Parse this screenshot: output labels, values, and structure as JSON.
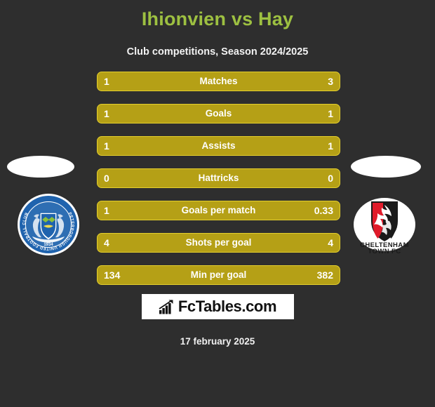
{
  "header": {
    "title": "Ihionvien vs Hay",
    "subtitle": "Club competitions, Season 2024/2025"
  },
  "teams": {
    "home": {
      "name": "Peterborough United Football Club",
      "crest_ring_text": "PETERBOROUGH UNITED FOOTBALL CLUB",
      "crest_year": "1934",
      "crest_primary_color": "#1f63ae",
      "crest_secondary_color": "#ffffff"
    },
    "away": {
      "name": "Cheltenham Town FC",
      "crest_line1": "CHELTENHAM",
      "crest_line2": "TOWN FC",
      "crest_primary_color": "#e01b2a",
      "crest_secondary_color": "#1a1a1a"
    }
  },
  "stats": {
    "rows": [
      {
        "label": "Matches",
        "home": "1",
        "away": "3"
      },
      {
        "label": "Goals",
        "home": "1",
        "away": "1"
      },
      {
        "label": "Assists",
        "home": "1",
        "away": "1"
      },
      {
        "label": "Hattricks",
        "home": "0",
        "away": "0"
      },
      {
        "label": "Goals per match",
        "home": "1",
        "away": "0.33"
      },
      {
        "label": "Shots per goal",
        "home": "4",
        "away": "4"
      },
      {
        "label": "Min per goal",
        "home": "134",
        "away": "382"
      }
    ]
  },
  "footer": {
    "brand": "FcTables.com",
    "brand_icon": "bar-chart-icon",
    "date": "17 february 2025"
  },
  "colors": {
    "background": "#2e2e2e",
    "title": "#9dc041",
    "bar_fill": "#b5a016",
    "bar_border": "#e4cf2d",
    "text": "#ffffff"
  }
}
